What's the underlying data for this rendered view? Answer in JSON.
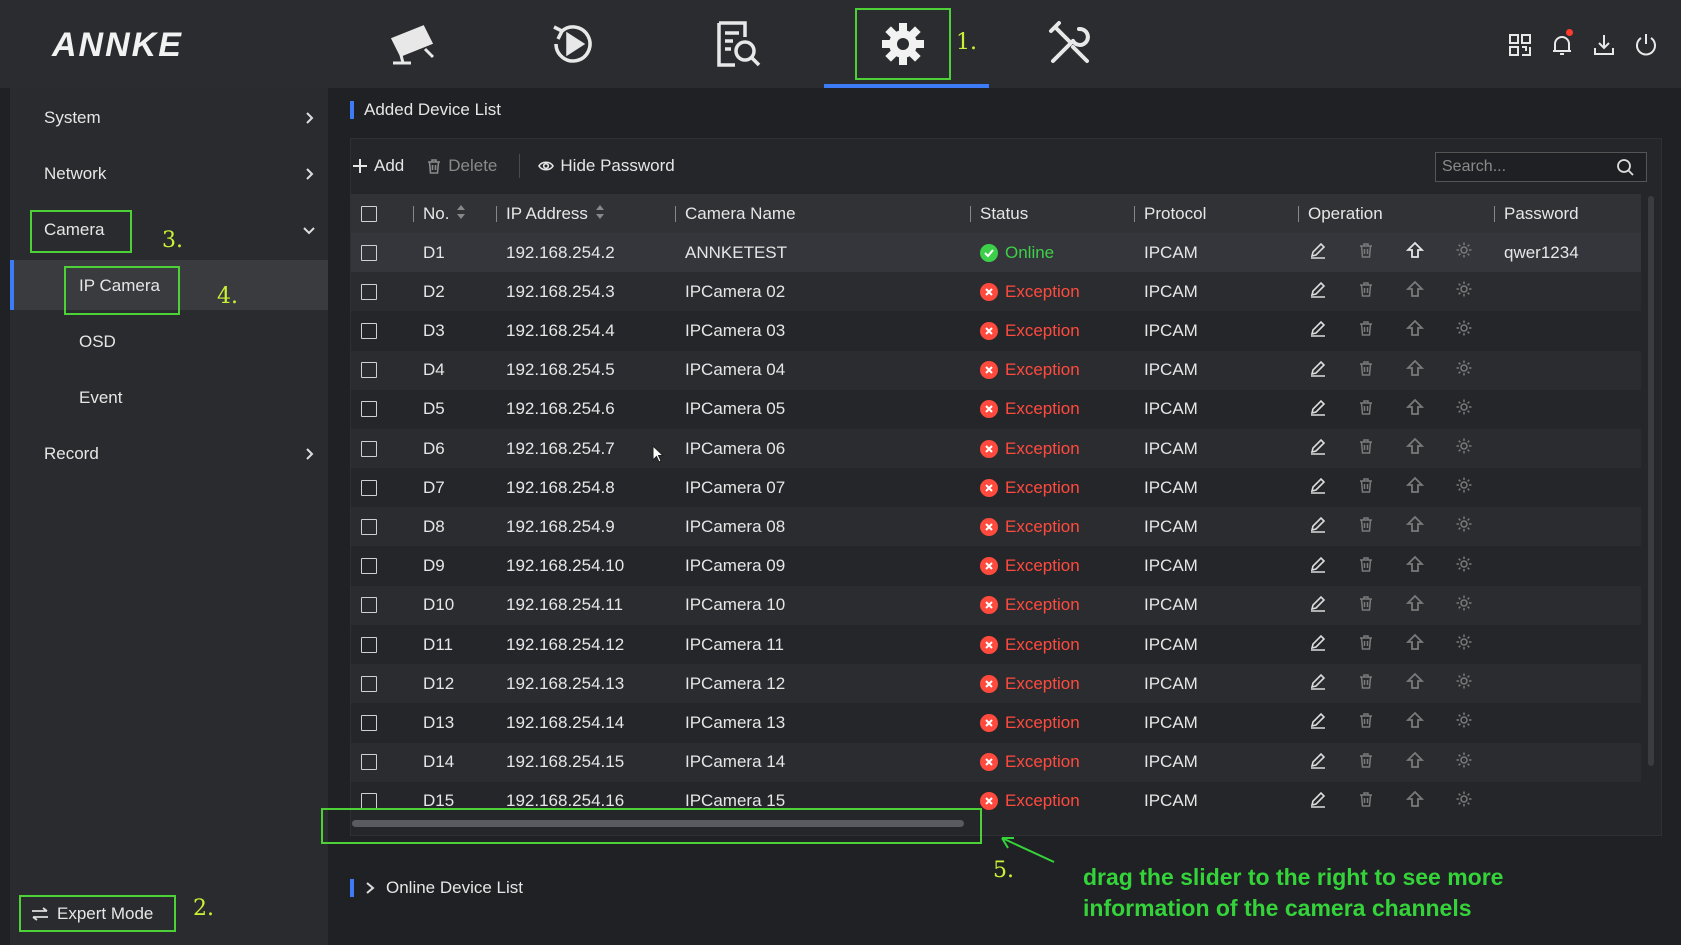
{
  "brand": {
    "logo": "ANNKE"
  },
  "nav": {
    "items": [
      {
        "name": "live-view",
        "icon": "camera-icon"
      },
      {
        "name": "playback",
        "icon": "playback-icon"
      },
      {
        "name": "search",
        "icon": "file-search-icon"
      },
      {
        "name": "configuration",
        "icon": "gear-icon",
        "active": true
      },
      {
        "name": "maintenance",
        "icon": "tools-icon"
      }
    ],
    "top_right": [
      "qr-code-icon",
      "bell-icon",
      "download-icon",
      "power-icon"
    ]
  },
  "annotations": {
    "a1": "1.",
    "a2": "2.",
    "a3": "3.",
    "a4": "4.",
    "a5": "5."
  },
  "sidebar": {
    "system": "System",
    "network": "Network",
    "camera": "Camera",
    "ip_camera": "IP Camera",
    "osd": "OSD",
    "event": "Event",
    "record": "Record",
    "expert_mode": "Expert Mode"
  },
  "added_list": {
    "title": "Added Device List",
    "toolbar": {
      "add": "Add",
      "delete": "Delete",
      "hide_password": "Hide Password"
    },
    "search_placeholder": "Search...",
    "columns": {
      "no": "No.",
      "ip": "IP Address",
      "name": "Camera Name",
      "status": "Status",
      "protocol": "Protocol",
      "operation": "Operation",
      "password": "Password"
    },
    "rows": [
      {
        "no": "D1",
        "ip": "192.168.254.2",
        "name": "ANNKETEST",
        "status": "Online",
        "protocol": "IPCAM",
        "password": "qwer1234"
      },
      {
        "no": "D2",
        "ip": "192.168.254.3",
        "name": "IPCamera 02",
        "status": "Exception",
        "protocol": "IPCAM",
        "password": ""
      },
      {
        "no": "D3",
        "ip": "192.168.254.4",
        "name": "IPCamera 03",
        "status": "Exception",
        "protocol": "IPCAM",
        "password": ""
      },
      {
        "no": "D4",
        "ip": "192.168.254.5",
        "name": "IPCamera 04",
        "status": "Exception",
        "protocol": "IPCAM",
        "password": ""
      },
      {
        "no": "D5",
        "ip": "192.168.254.6",
        "name": "IPCamera 05",
        "status": "Exception",
        "protocol": "IPCAM",
        "password": ""
      },
      {
        "no": "D6",
        "ip": "192.168.254.7",
        "name": "IPCamera 06",
        "status": "Exception",
        "protocol": "IPCAM",
        "password": ""
      },
      {
        "no": "D7",
        "ip": "192.168.254.8",
        "name": "IPCamera 07",
        "status": "Exception",
        "protocol": "IPCAM",
        "password": ""
      },
      {
        "no": "D8",
        "ip": "192.168.254.9",
        "name": "IPCamera 08",
        "status": "Exception",
        "protocol": "IPCAM",
        "password": ""
      },
      {
        "no": "D9",
        "ip": "192.168.254.10",
        "name": "IPCamera 09",
        "status": "Exception",
        "protocol": "IPCAM",
        "password": ""
      },
      {
        "no": "D10",
        "ip": "192.168.254.11",
        "name": "IPCamera 10",
        "status": "Exception",
        "protocol": "IPCAM",
        "password": ""
      },
      {
        "no": "D11",
        "ip": "192.168.254.12",
        "name": "IPCamera 11",
        "status": "Exception",
        "protocol": "IPCAM",
        "password": ""
      },
      {
        "no": "D12",
        "ip": "192.168.254.13",
        "name": "IPCamera 12",
        "status": "Exception",
        "protocol": "IPCAM",
        "password": ""
      },
      {
        "no": "D13",
        "ip": "192.168.254.14",
        "name": "IPCamera 13",
        "status": "Exception",
        "protocol": "IPCAM",
        "password": ""
      },
      {
        "no": "D14",
        "ip": "192.168.254.15",
        "name": "IPCamera 14",
        "status": "Exception",
        "protocol": "IPCAM",
        "password": ""
      },
      {
        "no": "D15",
        "ip": "192.168.254.16",
        "name": "IPCamera 15",
        "status": "Exception",
        "protocol": "IPCAM",
        "password": ""
      }
    ]
  },
  "online_list": {
    "title": "Online Device List"
  },
  "hint": {
    "line1": "drag the slider to the right to see more",
    "line2": "information of the camera channels"
  },
  "colors": {
    "accent": "#3d7bf7",
    "online": "#3ecf4a",
    "exception": "#ff4a3d",
    "annotation_box": "#4cd137",
    "hint_text": "#34d33a"
  }
}
